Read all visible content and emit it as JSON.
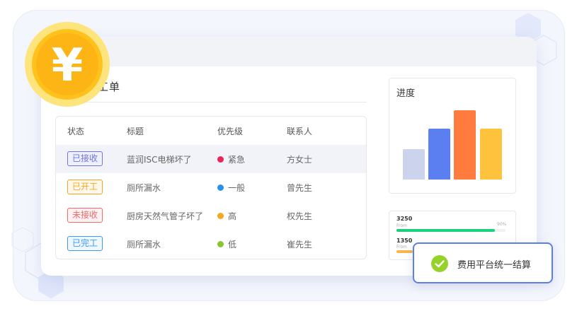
{
  "card": {
    "title": "工单"
  },
  "table": {
    "headers": [
      "状态",
      "标题",
      "优先级",
      "联系人"
    ],
    "rows": [
      {
        "status": "已接收",
        "title": "蓝润ISC电梯坏了",
        "priority": "紧急",
        "contact": "方女士",
        "status_color": "#6f74e0",
        "status_bg": "#eef0fd",
        "priority_color": "#e9255c"
      },
      {
        "status": "已开工",
        "title": "厕所漏水",
        "priority": "一般",
        "contact": "曾先生",
        "status_color": "#f5a623",
        "status_bg": "#fff8ea",
        "priority_color": "#2b91e8"
      },
      {
        "status": "未接收",
        "title": "厨房天然气管子坏了",
        "priority": "高",
        "contact": "权先生",
        "status_color": "#ef6b6b",
        "status_bg": "#fff1f1",
        "priority_color": "#f5a623"
      },
      {
        "status": "已完工",
        "title": "厕所漏水",
        "priority": "低",
        "contact": "崔先生",
        "status_color": "#3a9bf0",
        "status_bg": "#eef6ff",
        "priority_color": "#8ac633"
      }
    ]
  },
  "progress": {
    "title": "进度",
    "bars": [
      {
        "value": 43,
        "color": "#ccd3ec"
      },
      {
        "value": 73,
        "color": "#5b7ff0"
      },
      {
        "value": 99,
        "color": "#ff7b3e"
      },
      {
        "value": 73,
        "color": "#ffc23d"
      }
    ]
  },
  "stats": [
    {
      "value": "3250",
      "from": "From",
      "percent": "90%",
      "fraction": 0.9,
      "color": "#1ccf7c"
    },
    {
      "value": "1350",
      "from": "From",
      "percent": "",
      "fraction": 0.15,
      "color": "#f7b84b"
    }
  ],
  "coin": {
    "symbol": "¥"
  },
  "toast": {
    "text": "费用平台统一结算",
    "icon": "check-circle-icon",
    "accent": "#5b7fe6"
  }
}
